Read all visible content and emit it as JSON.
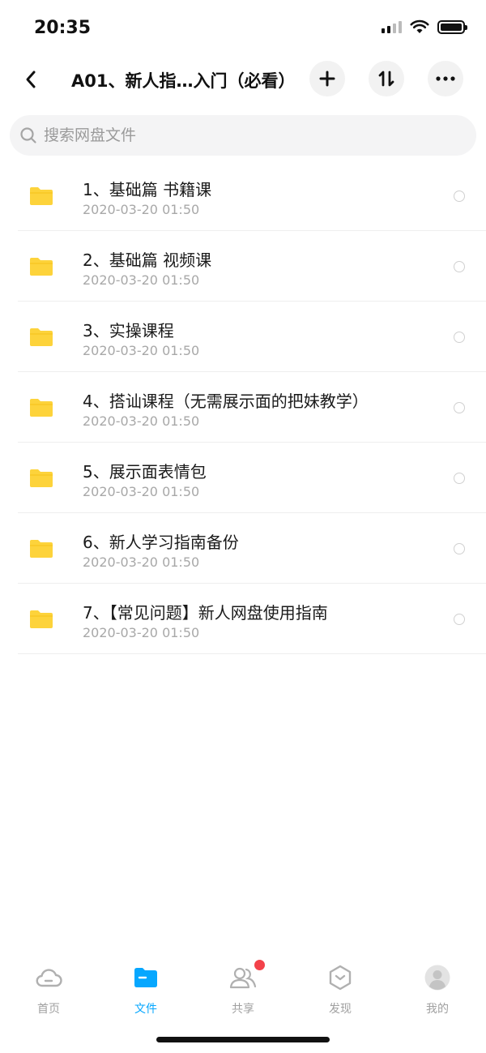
{
  "status_bar": {
    "time": "20:35"
  },
  "nav": {
    "title": "A01、新人指…入门（必看）"
  },
  "search": {
    "placeholder": "搜索网盘文件"
  },
  "files": [
    {
      "name": "1、基础篇  书籍课",
      "date": "2020-03-20 01:50"
    },
    {
      "name": "2、基础篇 视频课",
      "date": "2020-03-20 01:50"
    },
    {
      "name": "3、实操课程",
      "date": "2020-03-20 01:50"
    },
    {
      "name": "4、搭讪课程（无需展示面的把妹教学）",
      "date": "2020-03-20 01:50"
    },
    {
      "name": "5、展示面表情包",
      "date": "2020-03-20 01:50"
    },
    {
      "name": "6、新人学习指南备份",
      "date": "2020-03-20 01:50"
    },
    {
      "name": "7、【常见问题】新人网盘使用指南",
      "date": "2020-03-20 01:50"
    }
  ],
  "tabs": [
    {
      "label": "首页",
      "icon": "cloud-icon"
    },
    {
      "label": "文件",
      "icon": "folder-icon",
      "active": true
    },
    {
      "label": "共享",
      "icon": "people-icon",
      "badge": true
    },
    {
      "label": "发现",
      "icon": "discover-icon"
    },
    {
      "label": "我的",
      "icon": "avatar-icon"
    }
  ],
  "colors": {
    "accent": "#06a7ff",
    "folder": "#fdd33b",
    "badge": "#f3424a"
  }
}
